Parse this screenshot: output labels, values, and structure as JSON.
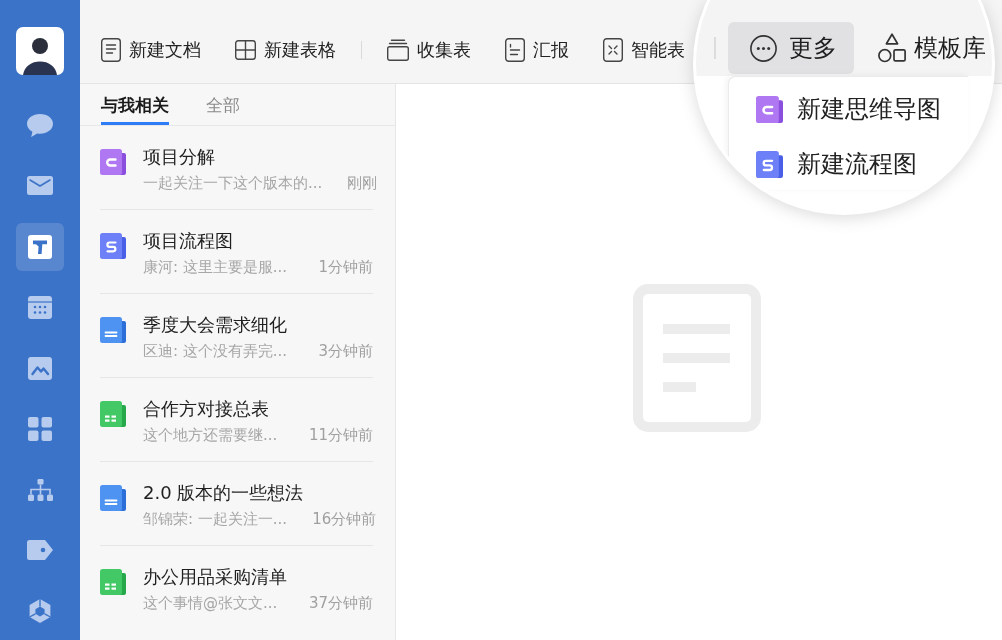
{
  "sidebar": {
    "items": [
      {
        "kind": "chat",
        "selected": false
      },
      {
        "kind": "mail",
        "selected": false
      },
      {
        "kind": "docs",
        "selected": true
      },
      {
        "kind": "calendar",
        "selected": false
      },
      {
        "kind": "image",
        "selected": false
      },
      {
        "kind": "apps",
        "selected": false
      },
      {
        "kind": "org",
        "selected": false
      },
      {
        "kind": "tag",
        "selected": false
      },
      {
        "kind": "logo",
        "selected": false
      }
    ]
  },
  "toolbar": {
    "groups": [
      {
        "items": [
          {
            "kind": "doc",
            "label": "新建文档"
          },
          {
            "kind": "table",
            "label": "新建表格"
          }
        ]
      },
      {
        "items": [
          {
            "kind": "collect",
            "label": "收集表"
          },
          {
            "kind": "report",
            "label": "汇报"
          },
          {
            "kind": "smart",
            "label": "智能表"
          }
        ]
      }
    ]
  },
  "magnifier": {
    "buttons": [
      {
        "kind": "more",
        "label": "更多",
        "active": true
      },
      {
        "kind": "template",
        "label": "模板库",
        "active": false
      }
    ],
    "menu": [
      {
        "kind": "mindmap",
        "label": "新建思维导图"
      },
      {
        "kind": "flowchart",
        "label": "新建流程图"
      }
    ]
  },
  "list": {
    "tabs": [
      {
        "label": "与我相关",
        "selected": true
      },
      {
        "label": "全部",
        "selected": false
      }
    ],
    "items": [
      {
        "kind": "mindmap",
        "title": "项目分解",
        "preview": "一起关注一下这个版本的...",
        "time": "刚刚"
      },
      {
        "kind": "flowchart",
        "title": "项目流程图",
        "preview": "康河: 这里主要是服...",
        "time": "1分钟前"
      },
      {
        "kind": "doc",
        "title": "季度大会需求细化",
        "preview": "区迪: 这个没有弄完...",
        "time": "3分钟前"
      },
      {
        "kind": "sheet",
        "title": "合作方对接总表",
        "preview": "这个地方还需要继...",
        "time": "11分钟前"
      },
      {
        "kind": "doc",
        "title": "2.0 版本的一些想法",
        "preview": "邹锦荣: 一起关注一...",
        "time": "16分钟前"
      },
      {
        "kind": "sheet",
        "title": "办公用品采购清单",
        "preview": "这个事情@张文文...",
        "time": "37分钟前"
      }
    ]
  }
}
